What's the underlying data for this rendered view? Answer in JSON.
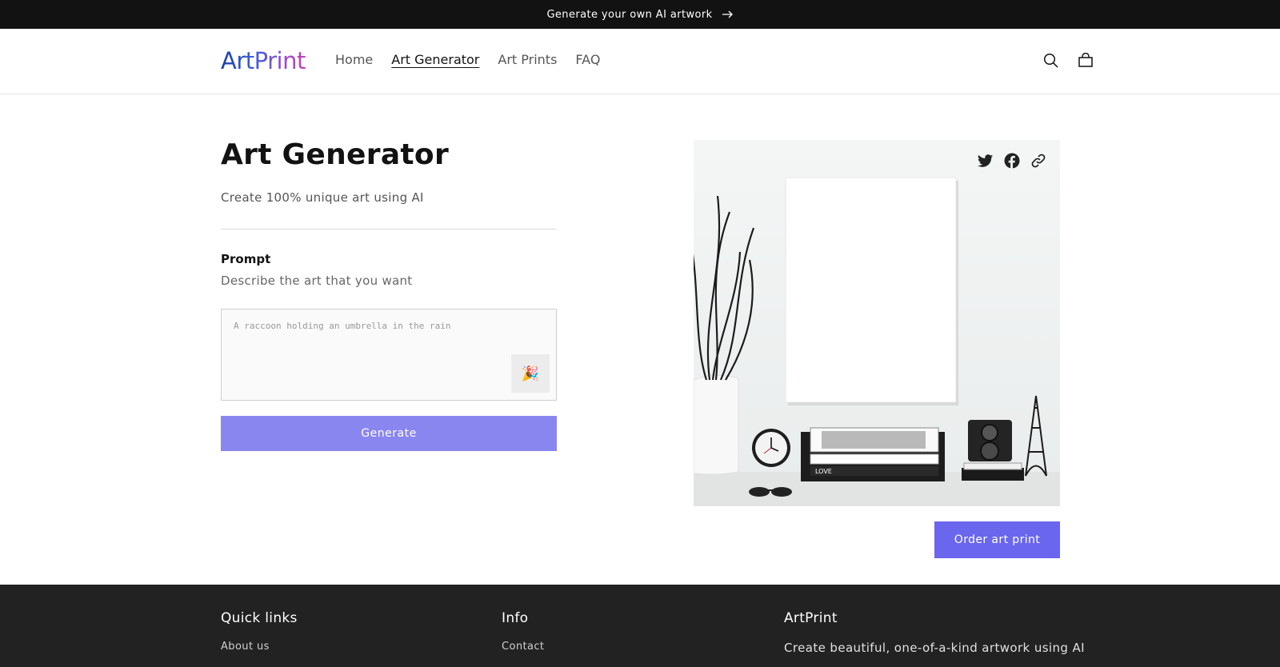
{
  "announcement": {
    "text": "Generate your own AI artwork",
    "icon": "arrow-right-icon"
  },
  "header": {
    "logo": "ArtPrint",
    "nav": [
      {
        "label": "Home",
        "active": false
      },
      {
        "label": "Art Generator",
        "active": true
      },
      {
        "label": "Art Prints",
        "active": false
      },
      {
        "label": "FAQ",
        "active": false
      }
    ],
    "icons": [
      "search-icon",
      "cart-icon"
    ]
  },
  "main": {
    "title": "Art Generator",
    "subtitle": "Create 100% unique art using AI",
    "prompt": {
      "label": "Prompt",
      "description": "Describe the art that you want",
      "placeholder": "A raccoon holding an umbrella in the rain",
      "value": "",
      "random_button_icon": "🎉"
    },
    "generate_label": "Generate"
  },
  "preview": {
    "share_icons": [
      "twitter-icon",
      "facebook-icon",
      "link-icon"
    ],
    "order_label": "Order art print"
  },
  "footer": {
    "columns": [
      {
        "heading": "Quick links",
        "links": [
          "About us"
        ]
      },
      {
        "heading": "Info",
        "links": [
          "Contact"
        ]
      },
      {
        "heading": "ArtPrint",
        "text": "Create beautiful, one-of-a-kind artwork using AI"
      }
    ]
  },
  "colors": {
    "accent": "#6a66ee",
    "accent_light": "#8a86f0",
    "announcement_bg": "#121212",
    "footer_bg": "#222222"
  }
}
